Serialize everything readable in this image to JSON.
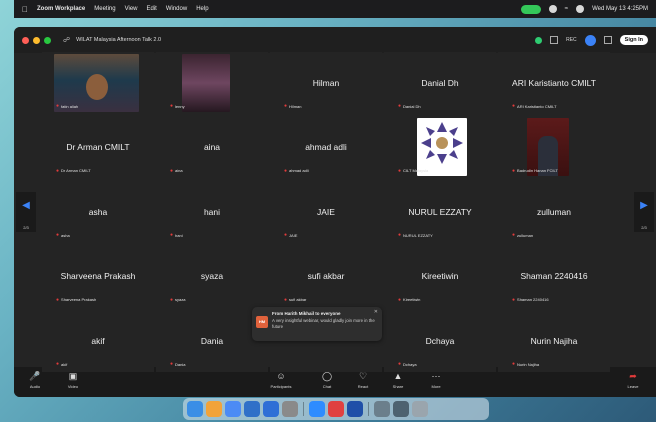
{
  "menubar": {
    "apple": "",
    "app": "Zoom Workplace",
    "menus": [
      "Meeting",
      "View",
      "Edit",
      "Window",
      "Help"
    ],
    "clock": "Wed May 13  4:25PM"
  },
  "window": {
    "title": "WILAT Malaysia Afternoon Talk 2.0",
    "rec_label": "REC",
    "signin_label": "Sign In"
  },
  "gallery": {
    "tiles": [
      {
        "big": "",
        "small": "fatin aliah"
      },
      {
        "big": "",
        "small": "lenny"
      },
      {
        "big": "Hilman",
        "small": "Hilman"
      },
      {
        "big": "Danial Dh",
        "small": "Danial Dh"
      },
      {
        "big": "ARI Karistianto CMILT",
        "small": "ARI Karistianto CMILT"
      },
      {
        "big": "Dr Arman CMILT",
        "small": "Dr Arman CMILT"
      },
      {
        "big": "aina",
        "small": "aina"
      },
      {
        "big": "ahmad adli",
        "small": "ahmad adli"
      },
      {
        "big": "",
        "small": "CILT Malaysia"
      },
      {
        "big": "",
        "small": "Badrudin Hanan FCILT"
      },
      {
        "big": "asha",
        "small": "asha"
      },
      {
        "big": "hani",
        "small": "hani"
      },
      {
        "big": "JAIE",
        "small": "JAIE"
      },
      {
        "big": "NURUL EZZATY",
        "small": "NURUL EZZATY"
      },
      {
        "big": "zulluman",
        "small": "zulluman"
      },
      {
        "big": "Sharveena Prakash",
        "small": "Sharveena Prakash"
      },
      {
        "big": "syaza",
        "small": "syaza"
      },
      {
        "big": "sufi akbar",
        "small": "sufi akbar"
      },
      {
        "big": "Kireetiwin",
        "small": "Kireetiwin"
      },
      {
        "big": "Shaman 2240416",
        "small": "Shaman 2240416"
      },
      {
        "big": "akif",
        "small": "akif"
      },
      {
        "big": "Dania",
        "small": "Dania"
      },
      {
        "big": "",
        "small": ""
      },
      {
        "big": "Dchaya",
        "small": "Dchaya"
      },
      {
        "big": "Nurin Najiha",
        "small": "Nurin Najiha"
      }
    ],
    "page_left": "2/3",
    "page_right": "2/3"
  },
  "chat": {
    "avatar": "HM",
    "from": "From Harith Mikhail to everyone",
    "message": "A very insightful webinar, would gladly join more in the future"
  },
  "toolbar": {
    "audio": "Audio",
    "video": "Video",
    "participants": "Participants",
    "participants_count": "31",
    "chat": "Chat",
    "react": "React",
    "share": "Share",
    "more": "More",
    "leave": "Leave"
  },
  "colors": {
    "accent": "#3b82f6",
    "muted_mic": "#e23b3b",
    "window_bg": "#242424"
  }
}
